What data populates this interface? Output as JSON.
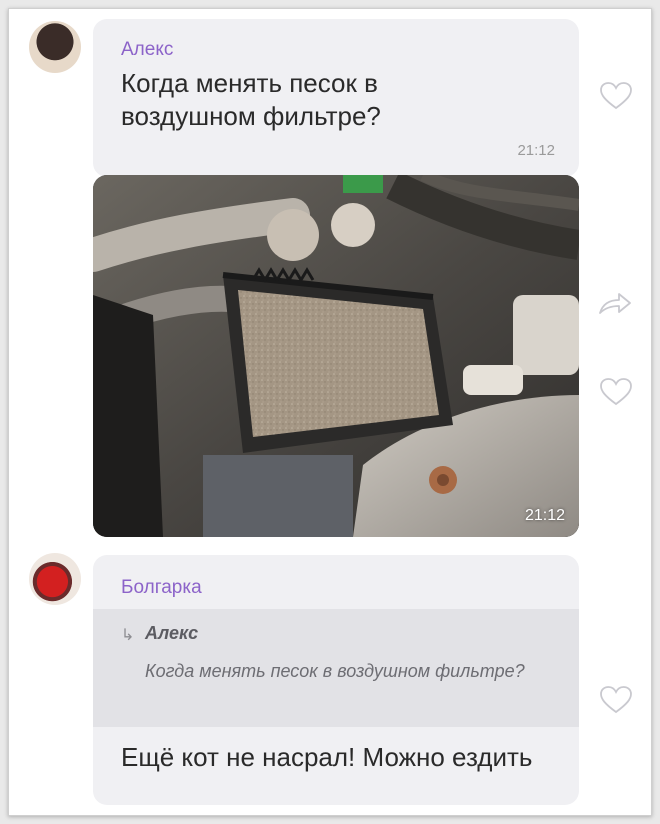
{
  "messages": [
    {
      "sender": "Алекс",
      "text": "Когда менять песок в воздушном фильтре?",
      "time": "21:12"
    },
    {
      "image_time": "21:12"
    },
    {
      "sender": "Болгарка",
      "reply": {
        "author": "Алекс",
        "text": "Когда менять песок в воздушном фильтре?"
      },
      "text": "Ещё кот не насрал! Можно ездить"
    }
  ],
  "colors": {
    "sender": "#8c63c9",
    "bubble": "#f0f0f3",
    "reply_bg": "#e2e2e6"
  },
  "icons": [
    "heart-outline-icon",
    "forward-arrow-icon"
  ]
}
